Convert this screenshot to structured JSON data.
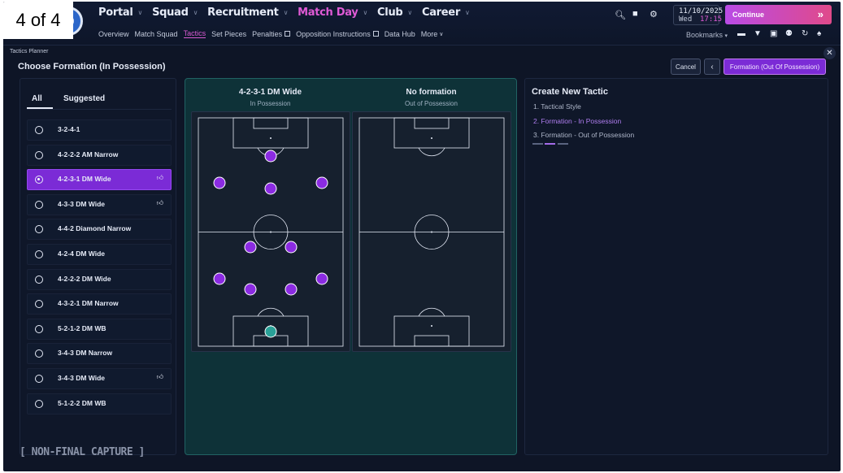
{
  "counter": "4 of 4",
  "nav": {
    "main": [
      {
        "label": "Portal",
        "active": false
      },
      {
        "label": "Squad",
        "active": false
      },
      {
        "label": "Recruitment",
        "active": false
      },
      {
        "label": "Match Day",
        "active": true
      },
      {
        "label": "Club",
        "active": false
      },
      {
        "label": "Career",
        "active": false
      }
    ],
    "sub": [
      {
        "label": "Overview"
      },
      {
        "label": "Match Squad"
      },
      {
        "label": "Tactics",
        "active": true
      },
      {
        "label": "Set Pieces"
      },
      {
        "label": "Penalties",
        "external": true
      },
      {
        "label": "Opposition Instructions",
        "external": true
      },
      {
        "label": "Data Hub"
      },
      {
        "label": "More"
      }
    ]
  },
  "header": {
    "date": "11/10/2025",
    "day": "Wed",
    "time": "17:15",
    "continue_label": "Continue",
    "bookmarks_label": "Bookmarks"
  },
  "planner": {
    "label": "Tactics Planner",
    "title": "Choose Formation (In Possession)",
    "cancel_label": "Cancel",
    "next_label": "Formation (Out Of Possession)"
  },
  "tabs": {
    "all": "All",
    "suggested": "Suggested"
  },
  "formations": [
    {
      "name": "3-2-4-1",
      "selected": false,
      "thumb": false
    },
    {
      "name": "4-2-2-2 AM Narrow",
      "selected": false,
      "thumb": false
    },
    {
      "name": "4-2-3-1 DM Wide",
      "selected": true,
      "thumb": true
    },
    {
      "name": "4-3-3 DM Wide",
      "selected": false,
      "thumb": true
    },
    {
      "name": "4-4-2 Diamond Narrow",
      "selected": false,
      "thumb": false
    },
    {
      "name": "4-2-4 DM Wide",
      "selected": false,
      "thumb": false
    },
    {
      "name": "4-2-2-2 DM Wide",
      "selected": false,
      "thumb": false
    },
    {
      "name": "4-3-2-1 DM Narrow",
      "selected": false,
      "thumb": false
    },
    {
      "name": "5-2-1-2 DM WB",
      "selected": false,
      "thumb": false
    },
    {
      "name": "3-4-3 DM Narrow",
      "selected": false,
      "thumb": false
    },
    {
      "name": "3-4-3 DM Wide",
      "selected": false,
      "thumb": true
    },
    {
      "name": "5-1-2-2 DM WB",
      "selected": false,
      "thumb": false
    }
  ],
  "pitches": {
    "left": {
      "title": "4-2-3-1 DM Wide",
      "subtitle": "In Possession"
    },
    "right": {
      "title": "No formation",
      "subtitle": "Out of Possession"
    }
  },
  "create": {
    "title": "Create New Tactic",
    "steps": [
      {
        "label": "1. Tactical Style",
        "active": false
      },
      {
        "label": "2. Formation - In Possession",
        "active": true
      },
      {
        "label": "3. Formation - Out of Possession",
        "active": false
      }
    ]
  },
  "watermark": "[ NON-FINAL CAPTURE ]",
  "colors": {
    "accent": "#7b2bd6",
    "active_nav": "#e05ad6",
    "player": "#8b2be2",
    "goalkeeper": "#2aa198"
  }
}
